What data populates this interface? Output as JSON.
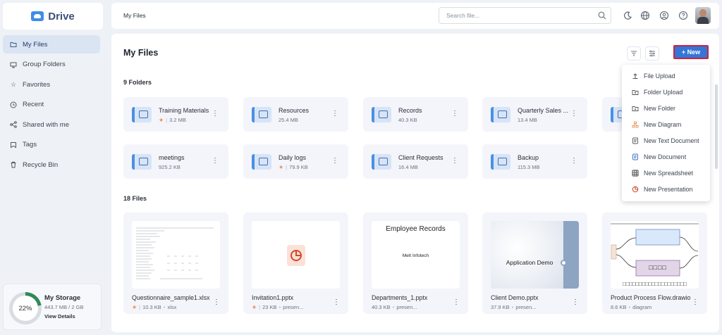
{
  "app": {
    "name": "Drive"
  },
  "sidebar": {
    "items": [
      {
        "label": "My Files",
        "icon": "folder-icon",
        "active": true
      },
      {
        "label": "Group Folders",
        "icon": "group-folder-icon"
      },
      {
        "label": "Favorites",
        "icon": "star-icon"
      },
      {
        "label": "Recent",
        "icon": "clock-icon"
      },
      {
        "label": "Shared with me",
        "icon": "share-icon"
      },
      {
        "label": "Tags",
        "icon": "tag-icon"
      },
      {
        "label": "Recycle Bin",
        "icon": "trash-icon"
      }
    ],
    "storage": {
      "percent": "22%",
      "percent_value": 22,
      "title": "My Storage",
      "usage": "443.7 MB / 2 GB",
      "link": "View Details"
    }
  },
  "topbar": {
    "breadcrumb": "My Files",
    "search_placeholder": "Search file...",
    "icons": [
      "search-icon",
      "moon-icon",
      "globe-icon",
      "user-circle-icon",
      "help-icon",
      "avatar"
    ]
  },
  "main": {
    "title": "My Files",
    "new_label": "+ New",
    "folders_heading": "9 Folders",
    "files_heading": "18 Files",
    "folders": [
      {
        "name": "Training Materials",
        "size": "3.2 MB",
        "starred": true
      },
      {
        "name": "Resources",
        "size": "25.4 MB",
        "starred": false
      },
      {
        "name": "Records",
        "size": "40.3 KB",
        "starred": false
      },
      {
        "name": "Quarterly Sales ...",
        "size": "13.4 MB",
        "starred": false
      },
      {
        "name": "meetings",
        "size": "925.2 KB",
        "starred": false
      },
      {
        "name": "Daily logs",
        "size": "79.9 KB",
        "starred": true
      },
      {
        "name": "Client Requests",
        "size": "16.4 MB",
        "starred": false
      },
      {
        "name": "Backup",
        "size": "115.3 MB",
        "starred": false
      }
    ],
    "files": [
      {
        "name": "Questionnaire_sample1.xlsx",
        "size": "10.3 KB",
        "type": "xlsx",
        "starred": true
      },
      {
        "name": "Invitation1.pptx",
        "size": "23 KB",
        "type": "presen...",
        "starred": true
      },
      {
        "name": "Departments_1.pptx",
        "size": "40.3 KB",
        "type": "presen...",
        "starred": false,
        "thumb_title": "Employee Records",
        "thumb_sub": "Melt Infotech"
      },
      {
        "name": "Client Demo.pptx",
        "size": "37.9 KB",
        "type": "presen...",
        "starred": false,
        "thumb_title": "Application Demo"
      },
      {
        "name": "Product Process Flow.drawio",
        "size": "8.6 KB",
        "type": "diagram",
        "starred": false,
        "thumb_text": "□□□□",
        "thumb_strip": "□□□□□□□□□□□□□□□□□□□□"
      }
    ]
  },
  "new_menu": {
    "items": [
      {
        "label": "File Upload",
        "icon": "upload-icon"
      },
      {
        "label": "Folder Upload",
        "icon": "folder-upload-icon"
      },
      {
        "label": "New Folder",
        "icon": "new-folder-icon"
      },
      {
        "label": "New Diagram",
        "icon": "diagram-icon"
      },
      {
        "label": "New Text Document",
        "icon": "text-doc-icon"
      },
      {
        "label": "New Document",
        "icon": "document-icon"
      },
      {
        "label": "New Spreadsheet",
        "icon": "spreadsheet-icon"
      },
      {
        "label": "New Presentation",
        "icon": "presentation-icon"
      }
    ]
  },
  "colors": {
    "accent": "#3475d8",
    "highlight": "#d0213b",
    "star": "#e8935a",
    "storage": "#2e8b57"
  }
}
